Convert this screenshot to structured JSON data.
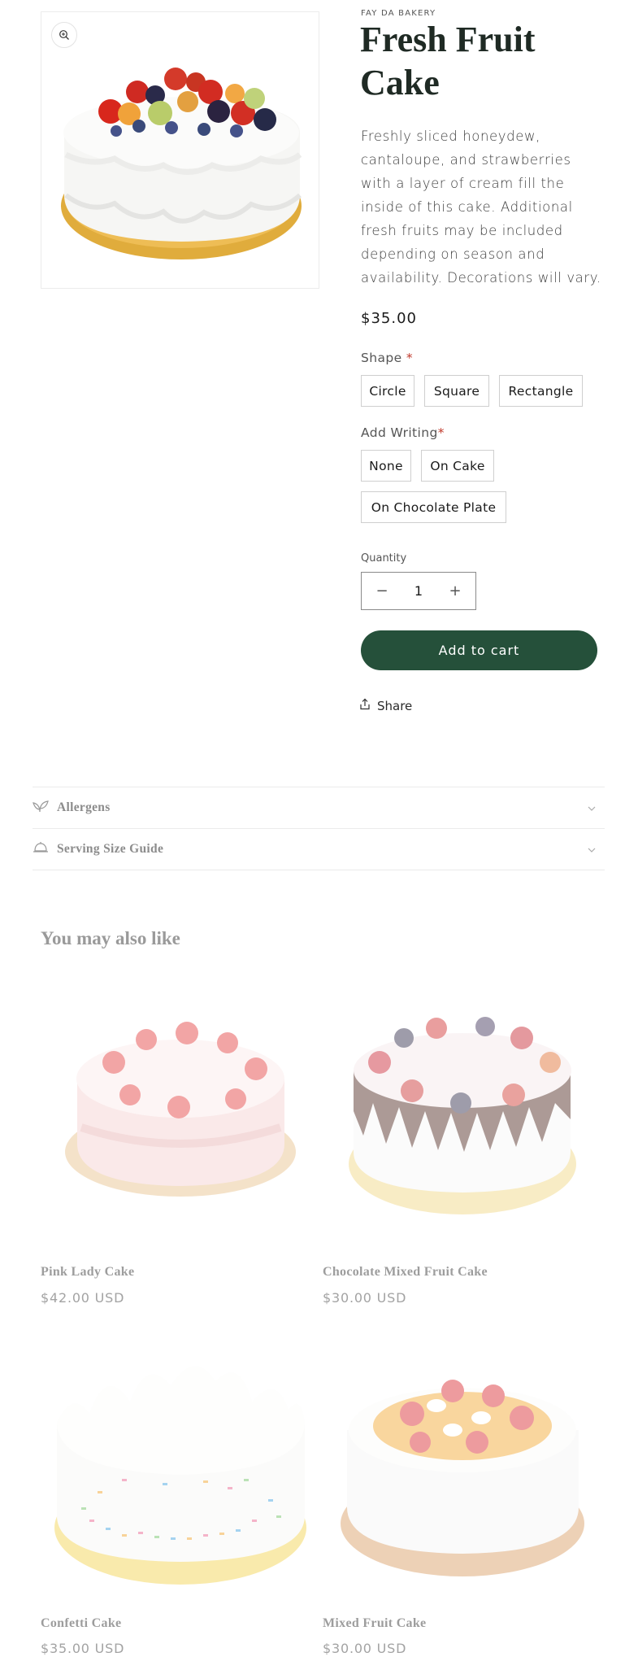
{
  "product": {
    "vendor": "FAY DA BAKERY",
    "title": "Fresh Fruit Cake",
    "description": "Freshly sliced honeydew, cantaloupe, and strawberries with a layer of cream fill the inside of this cake. Additional fresh fruits may be included depending on season and availability. Decorations will vary.",
    "price": "$35.00",
    "image_icon": "zoom-icon"
  },
  "options": {
    "shape": {
      "label": "Shape",
      "required_mark": "*",
      "values": [
        "Circle",
        "Square",
        "Rectangle"
      ]
    },
    "writing": {
      "label": "Add Writing",
      "required_mark": "*",
      "values": [
        "None",
        "On Cake",
        "On Chocolate Plate"
      ]
    }
  },
  "quantity": {
    "label": "Quantity",
    "value": "1",
    "minus": "−",
    "plus": "+"
  },
  "actions": {
    "add_to_cart": "Add to cart",
    "share": "Share"
  },
  "accordions": [
    {
      "title": "Allergens",
      "icon": "leaf-icon"
    },
    {
      "title": "Serving Size Guide",
      "icon": "serving-dome-icon"
    }
  ],
  "recommendations": {
    "heading": "You may also like",
    "items": [
      {
        "name": "Pink Lady Cake",
        "price": "$42.00 USD"
      },
      {
        "name": "Chocolate Mixed Fruit Cake",
        "price": "$30.00 USD"
      },
      {
        "name": "Confetti Cake",
        "price": "$35.00 USD"
      },
      {
        "name": "Mixed Fruit Cake",
        "price": "$30.00 USD"
      }
    ]
  },
  "colors": {
    "primary_button": "#25503a",
    "title": "#1f2a24",
    "required": "#c0392b"
  }
}
